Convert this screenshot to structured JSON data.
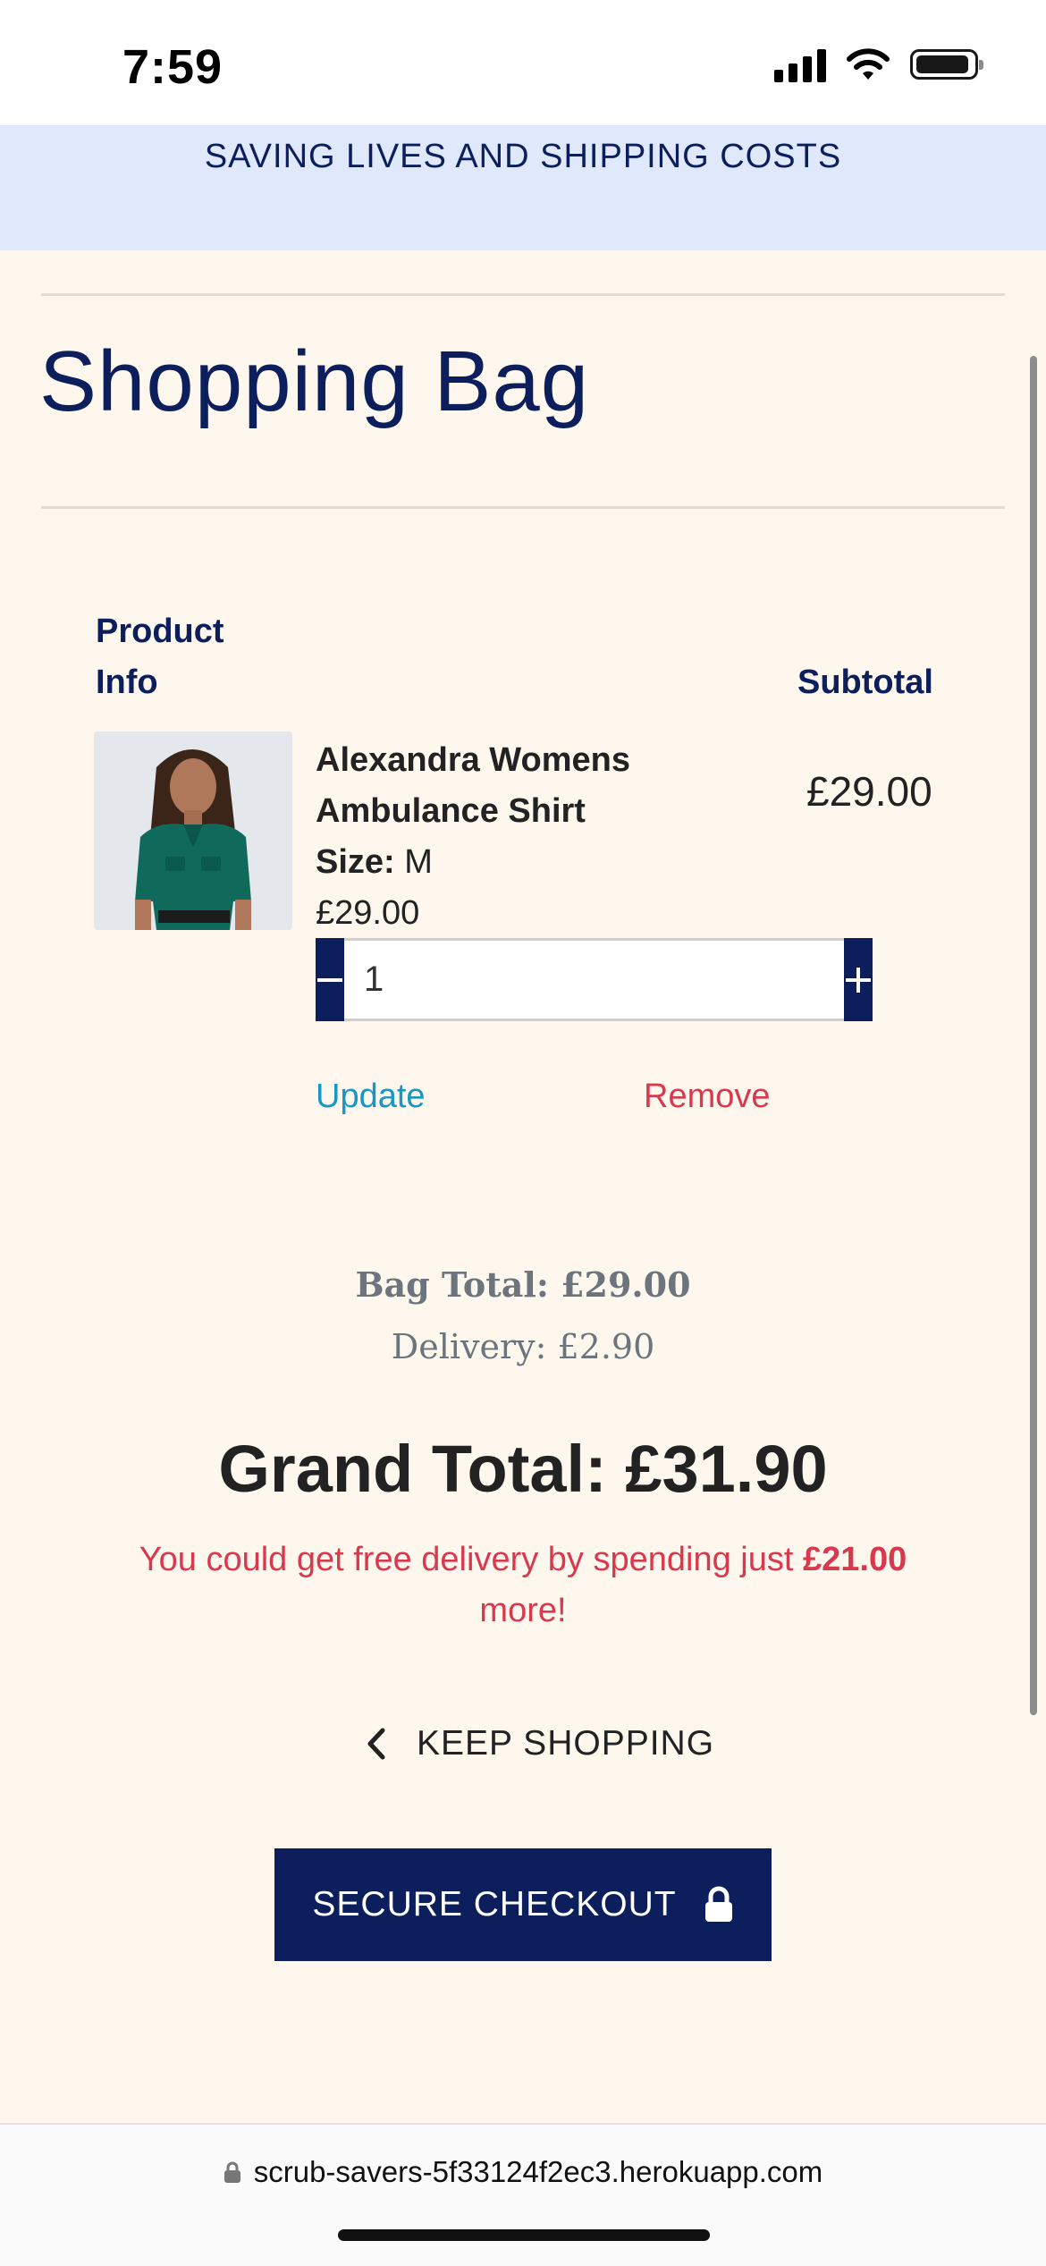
{
  "status_bar": {
    "time": "7:59"
  },
  "promo_banner": {
    "text": "SAVING LIVES AND SHIPPING COSTS"
  },
  "page": {
    "title": "Shopping Bag"
  },
  "table": {
    "header_product": "Product Info",
    "header_subtotal": "Subtotal"
  },
  "item": {
    "name": "Alexandra Womens Ambulance Shirt",
    "size_label": "Size:",
    "size_value": "M",
    "price": "£29.00",
    "quantity": "1",
    "subtotal": "£29.00",
    "update_label": "Update",
    "remove_label": "Remove"
  },
  "totals": {
    "bag_total": "Bag Total: £29.00",
    "delivery": "Delivery: £2.90",
    "grand_total": "Grand Total: £31.90",
    "free_delivery_prefix": "You could get free delivery by spending just",
    "free_delivery_amount": "£21.00",
    "free_delivery_suffix": "more!"
  },
  "actions": {
    "keep_shopping": "KEEP SHOPPING",
    "secure_checkout": "SECURE CHECKOUT"
  },
  "browser": {
    "url": "scrub-savers-5f33124f2ec3.herokuapp.com"
  },
  "colors": {
    "primary": "#0c1f5c",
    "page_background": "#fdf7ee",
    "banner_background": "#e0e8fb",
    "update_link": "#1896c4",
    "remove_link": "#d9394e"
  },
  "icons": [
    "signal-icon",
    "wifi-icon",
    "battery-icon",
    "minus-icon",
    "plus-icon",
    "chevron-left-icon",
    "lock-icon"
  ]
}
